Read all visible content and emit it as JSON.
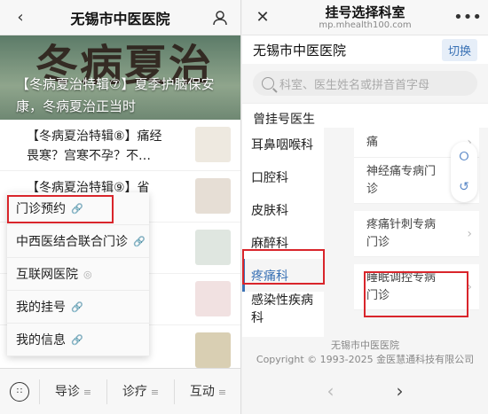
{
  "left": {
    "title": "无锡市中医医院",
    "banner": {
      "calligraphy": "冬病夏治",
      "text": "【冬病夏治特辑⑦】夏季护脑保安康，冬病夏治正当时"
    },
    "feed": [
      {
        "title": "【冬病夏治特辑⑧】痛经畏寒？宫寒不孕？不…",
        "thumb": "冬病夏治"
      },
      {
        "title": "【冬病夏治特辑⑨】省",
        "thumb": "冬病夏治"
      },
      {
        "title": "",
        "thumb": ""
      },
      {
        "title": "",
        "thumb": ""
      },
      {
        "title": "",
        "thumb": ""
      }
    ],
    "menu": [
      {
        "label": "门诊预约"
      },
      {
        "label": "中西医结合联合门诊"
      },
      {
        "label": "互联网医院"
      },
      {
        "label": "我的挂号"
      },
      {
        "label": "我的信息"
      }
    ],
    "tabs": [
      {
        "label": "导诊"
      },
      {
        "label": "诊疗"
      },
      {
        "label": "互动"
      }
    ]
  },
  "right": {
    "title": "挂号选择科室",
    "subtitle": "mp.mhealth100.com",
    "hospital": "无锡市中医医院",
    "switch_label": "切换",
    "search_placeholder": "科室、医生姓名或拼音首字母",
    "previous_doctors": "曾挂号医生",
    "departments": [
      {
        "label": "耳鼻咽喉科"
      },
      {
        "label": "口腔科"
      },
      {
        "label": "皮肤科"
      },
      {
        "label": "麻醉科"
      },
      {
        "label": "疼痛科"
      },
      {
        "label": "感染性疾病科"
      }
    ],
    "subdepts": [
      {
        "label": "痛"
      },
      {
        "label": "神经痛专病门诊"
      },
      {
        "label": "疼痛针刺专病门诊"
      },
      {
        "label": "睡眠调控专病门诊"
      }
    ],
    "footer_name": "无锡市中医医院",
    "footer_copy": "Copyright © 1993-2025 金医慧通科技有限公司"
  }
}
